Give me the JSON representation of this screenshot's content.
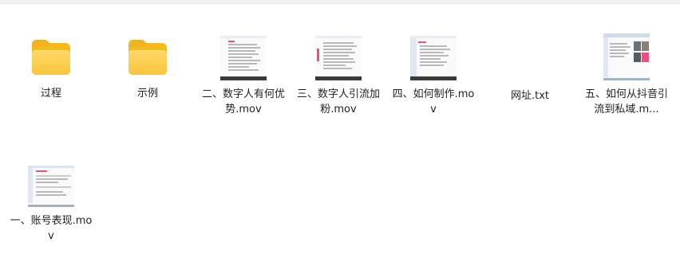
{
  "files": [
    {
      "name": "过程",
      "type": "folder",
      "icon": "folder-icon"
    },
    {
      "name": "示例",
      "type": "folder",
      "icon": "folder-icon"
    },
    {
      "name": "二、数字人有何优势.mov",
      "type": "video",
      "icon": "video-thumbnail"
    },
    {
      "name": "三、数字人引流加粉.mov",
      "type": "video",
      "icon": "video-thumbnail"
    },
    {
      "name": "四、如何制作.mov",
      "type": "video",
      "icon": "video-thumbnail"
    },
    {
      "name": "网址.txt",
      "type": "text",
      "icon": "text-file-icon"
    },
    {
      "name": "五、如何从抖音引流到私域.m...",
      "type": "video",
      "icon": "video-thumbnail"
    },
    {
      "name": "一、账号表现.mov",
      "type": "video",
      "icon": "video-thumbnail"
    }
  ],
  "colors": {
    "folder": "#fbc53b",
    "accent": "#ea4f85",
    "background": "#ffffff"
  }
}
